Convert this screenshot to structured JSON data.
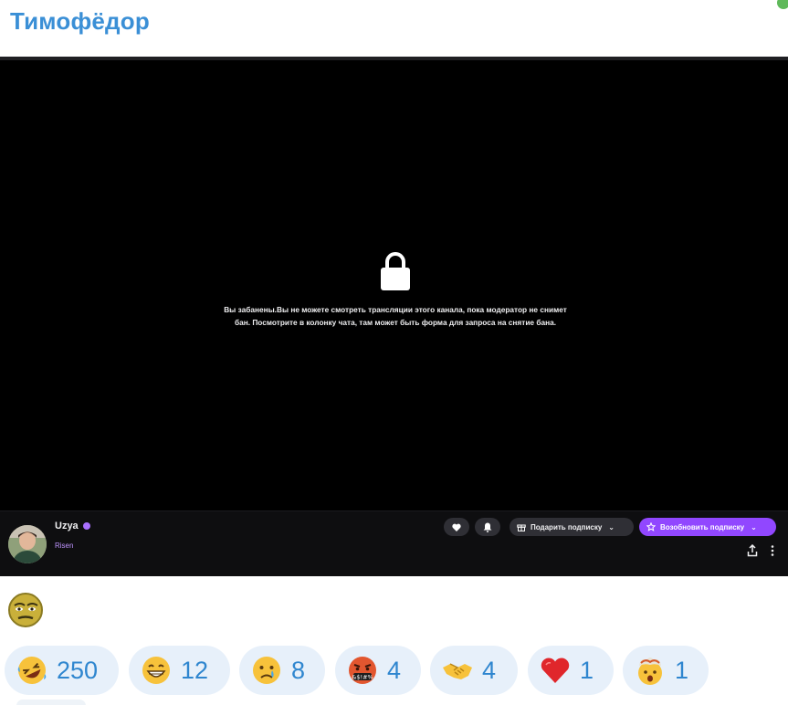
{
  "message": {
    "sender": "Тимофёдор"
  },
  "player": {
    "ban_message_line1": "Вы забанены.Вы не можете смотреть трансляции этого канала, пока модератор не снимет",
    "ban_message_line2": "бан. Посмотрите в колонку чата, там может быть форма для запроса на снятие бана.",
    "lock_icon": "lock-icon"
  },
  "channel": {
    "name": "Uzya",
    "game": "Risen",
    "verified": true,
    "gift_label": "Подарить подписку",
    "resub_label": "Возобновить подписку",
    "accent_color": "#9147ff"
  },
  "reactions": [
    {
      "emoji": "rofl",
      "count": "250"
    },
    {
      "emoji": "grin",
      "count": "12"
    },
    {
      "emoji": "cry",
      "count": "8"
    },
    {
      "emoji": "cursing",
      "count": "4"
    },
    {
      "emoji": "handshake",
      "count": "4"
    },
    {
      "emoji": "heart",
      "count": "1"
    },
    {
      "emoji": "mind-blown",
      "count": "1"
    }
  ],
  "colors": {
    "sender": "#3a8fd6",
    "reaction_bg": "#e7f0fa",
    "reaction_text": "#2f86cf"
  }
}
